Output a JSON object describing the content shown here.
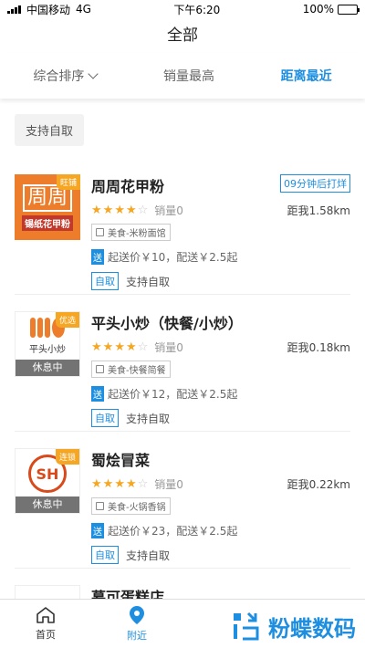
{
  "status_bar": {
    "carrier": "中国移动",
    "network": "4G",
    "time": "下午6:20",
    "battery": "100%"
  },
  "page_title": "全部",
  "sort_tabs": [
    {
      "label": "综合排序",
      "active": false
    },
    {
      "label": "销量最高",
      "active": false
    },
    {
      "label": "距离最近",
      "active": true
    }
  ],
  "filter_chip": "支持自取",
  "shops": [
    {
      "name": "周周花甲粉",
      "corner_badge": "旺铺",
      "thumb_text": "周周",
      "thumb_sub": "锡纸花甲粉",
      "later_tag": "09分钟后打烊",
      "rating": 4,
      "sales": "销量0",
      "distance": "距我1.58km",
      "category": "美食-米粉面馆",
      "delivery_tag": "送",
      "delivery": "起送价￥10，配送￥2.5起",
      "pickup_tag": "自取",
      "pickup": "支持自取",
      "rest": ""
    },
    {
      "name": "平头小炒（快餐/小炒）",
      "corner_badge": "优选",
      "thumb_text": "平头小炒",
      "thumb_sub": "",
      "later_tag": "",
      "rating": 4,
      "sales": "销量0",
      "distance": "距我0.18km",
      "category": "美食-快餐简餐",
      "delivery_tag": "送",
      "delivery": "起送价￥12，配送￥2.5起",
      "pickup_tag": "自取",
      "pickup": "支持自取",
      "rest": "休息中"
    },
    {
      "name": "蜀烩冒菜",
      "corner_badge": "连锁",
      "thumb_text": "SH",
      "thumb_sub": "",
      "later_tag": "",
      "rating": 4,
      "sales": "销量0",
      "distance": "距我0.22km",
      "category": "美食-火锅香锅",
      "delivery_tag": "送",
      "delivery": "起送价￥23，配送￥2.5起",
      "pickup_tag": "自取",
      "pickup": "支持自取",
      "rest": "休息中"
    }
  ],
  "partial_shop": {
    "name": "慕可蛋糕店"
  },
  "bottom_nav": {
    "home": "首页",
    "nearby": "附近"
  },
  "watermark": "粉蝶数码",
  "colors": {
    "accent": "#1e8fe0",
    "star": "#f5a623",
    "orange": "#ee7d2b"
  }
}
